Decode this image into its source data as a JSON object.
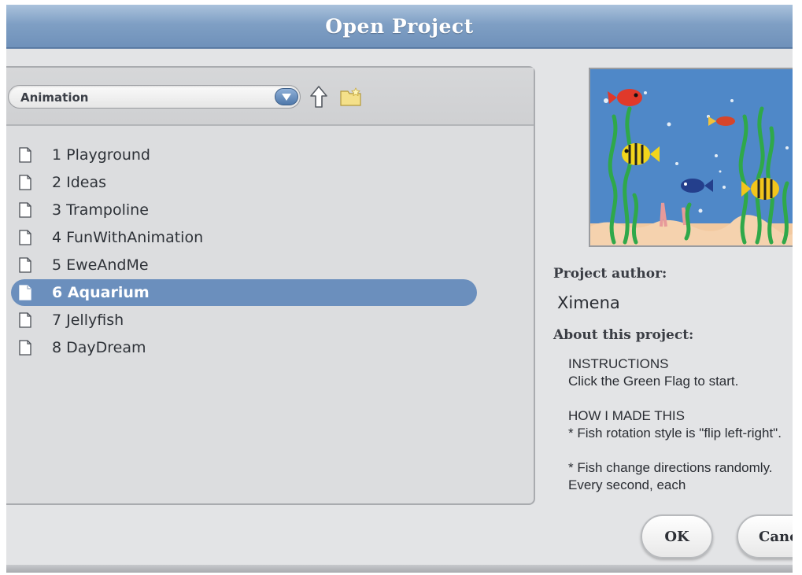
{
  "dialog": {
    "title": "Open Project"
  },
  "folder": {
    "selected": "Animation"
  },
  "files": [
    {
      "label": "1 Playground",
      "selected": false
    },
    {
      "label": "2 Ideas",
      "selected": false
    },
    {
      "label": "3 Trampoline",
      "selected": false
    },
    {
      "label": "4 FunWithAnimation",
      "selected": false
    },
    {
      "label": "5 EweAndMe",
      "selected": false
    },
    {
      "label": "6 Aquarium",
      "selected": true
    },
    {
      "label": "7 Jellyfish",
      "selected": false
    },
    {
      "label": "8 DayDream",
      "selected": false
    }
  ],
  "details": {
    "author_label": "Project author:",
    "author": "Ximena",
    "about_label": "About this project:",
    "notes": "INSTRUCTIONS\nClick the Green Flag to start.\n\nHOW I MADE THIS\n* Fish rotation style is \"flip left-right\".\n\n* Fish change directions randomly. Every second, each"
  },
  "buttons": {
    "ok": "OK",
    "cancel": "Cancel"
  },
  "icons": {
    "dropdown": "triangle-down-icon",
    "up": "up-arrow-icon",
    "new_folder": "new-folder-icon",
    "file": "file-icon"
  },
  "colors": {
    "title_bar": "#7f9fc4",
    "selection": "#6b8fbd"
  }
}
